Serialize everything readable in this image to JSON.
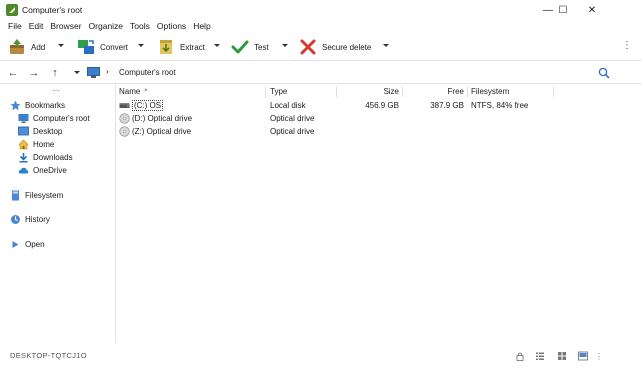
{
  "window": {
    "title": "Computer's root",
    "minimize": "—",
    "maximize": "☐",
    "close": "✕"
  },
  "menu": [
    "File",
    "Edit",
    "Browser",
    "Organize",
    "Tools",
    "Options",
    "Help"
  ],
  "toolbar": {
    "add": "Add",
    "convert": "Convert",
    "extract": "Extract",
    "test": "Test",
    "secure_delete": "Secure delete",
    "more": "⋮",
    "colors": {
      "add": "#5a8f2e",
      "convert_green": "#2f9e4a",
      "convert_blue": "#2a6fbf",
      "extract": "#d9b440",
      "test": "#2a9a3a",
      "secure_delete": "#d43a2f"
    }
  },
  "address": {
    "back": "←",
    "forward": "→",
    "up": "↑",
    "path": "Computer's root",
    "icons": [
      "arrow-left-icon",
      "arrow-right-icon",
      "arrow-up-icon",
      "monitor-icon",
      "search-icon"
    ]
  },
  "sidebar": {
    "more": "···",
    "bookmarks": {
      "label": "Bookmarks",
      "items": [
        "Computer's root",
        "Desktop",
        "Home",
        "Downloads",
        "OneDrive"
      ]
    },
    "filesystem": "Filesystem",
    "history": "History",
    "open": "Open"
  },
  "columns": {
    "name": "Name",
    "sort_indicator": "^",
    "type": "Type",
    "size": "Size",
    "free": "Free",
    "filesystem": "Filesystem"
  },
  "rows": [
    {
      "name": "(C:) OS",
      "type": "Local disk",
      "size": "456.9 GB",
      "free": "387.9 GB",
      "filesystem": "NTFS, 84% free",
      "icon": "hard-drive-icon"
    },
    {
      "name": "(D:) Optical drive",
      "type": "Optical drive",
      "size": "",
      "free": "",
      "filesystem": "",
      "icon": "optical-disc-icon"
    },
    {
      "name": "(Z:) Optical drive",
      "type": "Optical drive",
      "size": "",
      "free": "",
      "filesystem": "",
      "icon": "optical-disc-icon"
    }
  ],
  "status": {
    "computer_name": "DESKTOP-TQTCJ1O",
    "icons": [
      "lock-icon",
      "details-view-icon",
      "tiles-view-icon",
      "preview-pane-icon",
      "more-icon"
    ]
  }
}
